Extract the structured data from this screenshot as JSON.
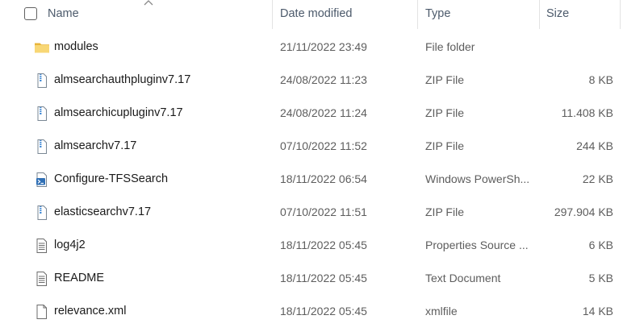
{
  "columns": {
    "name": "Name",
    "date_modified": "Date modified",
    "type": "Type",
    "size": "Size"
  },
  "files": [
    {
      "name": "modules",
      "date": "21/11/2022 23:49",
      "type": "File folder",
      "size": "",
      "icon": "folder-icon"
    },
    {
      "name": "almsearchauthpluginv7.17",
      "date": "24/08/2022 11:23",
      "type": "ZIP File",
      "size": "8 KB",
      "icon": "zip-file-icon"
    },
    {
      "name": "almsearchicupluginv7.17",
      "date": "24/08/2022 11:24",
      "type": "ZIP File",
      "size": "11.408 KB",
      "icon": "zip-file-icon"
    },
    {
      "name": "almsearchv7.17",
      "date": "07/10/2022 11:52",
      "type": "ZIP File",
      "size": "244 KB",
      "icon": "zip-file-icon"
    },
    {
      "name": "Configure-TFSSearch",
      "date": "18/11/2022 06:54",
      "type": "Windows PowerSh...",
      "size": "22 KB",
      "icon": "powershell-script-icon"
    },
    {
      "name": "elasticsearchv7.17",
      "date": "07/10/2022 11:51",
      "type": "ZIP File",
      "size": "297.904 KB",
      "icon": "zip-file-icon"
    },
    {
      "name": "log4j2",
      "date": "18/11/2022 05:45",
      "type": "Properties Source ...",
      "size": "6 KB",
      "icon": "text-file-icon"
    },
    {
      "name": "README",
      "date": "18/11/2022 05:45",
      "type": "Text Document",
      "size": "5 KB",
      "icon": "text-file-icon"
    },
    {
      "name": "relevance.xml",
      "date": "18/11/2022 05:45",
      "type": "xmlfile",
      "size": "14 KB",
      "icon": "blank-file-icon"
    }
  ],
  "colors": {
    "folder": "#f2c94c",
    "zip_accent": "#3a86d4",
    "header_text": "#4c5a6b",
    "detail_text": "#5d5d5d"
  }
}
